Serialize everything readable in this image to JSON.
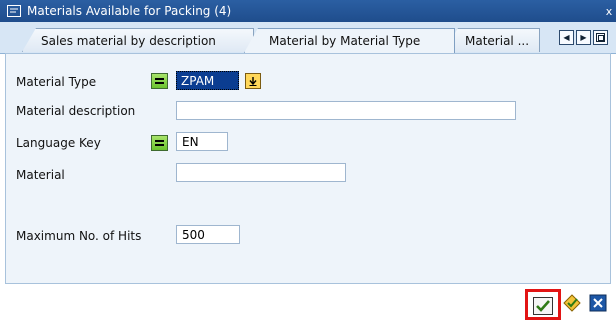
{
  "window": {
    "title": "Materials Available for Packing (4)",
    "close_glyph": "x"
  },
  "tabs": [
    {
      "label": "Sales material by description",
      "active": false
    },
    {
      "label": "Material by Material Type",
      "active": true
    },
    {
      "label": "Material ...",
      "active": false
    }
  ],
  "tab_nav": {
    "prev_glyph": "◀",
    "next_glyph": "▶"
  },
  "form": {
    "material_type": {
      "label": "Material Type",
      "value": "ZPAM"
    },
    "material_description": {
      "label": "Material description",
      "value": ""
    },
    "language_key": {
      "label": "Language Key",
      "value": "EN"
    },
    "material": {
      "label": "Material",
      "value": ""
    },
    "max_hits": {
      "label": "Maximum No. of Hits",
      "value": "500"
    }
  },
  "colors": {
    "titlebar": "#1f4d8c",
    "panel_bg": "#eef4fa",
    "highlight": "#e21414",
    "selection_bg": "#0b3d91"
  },
  "icons": {
    "continue": "check-icon",
    "multiple_selection": "multiple-selection-icon",
    "cancel": "cancel-icon"
  }
}
